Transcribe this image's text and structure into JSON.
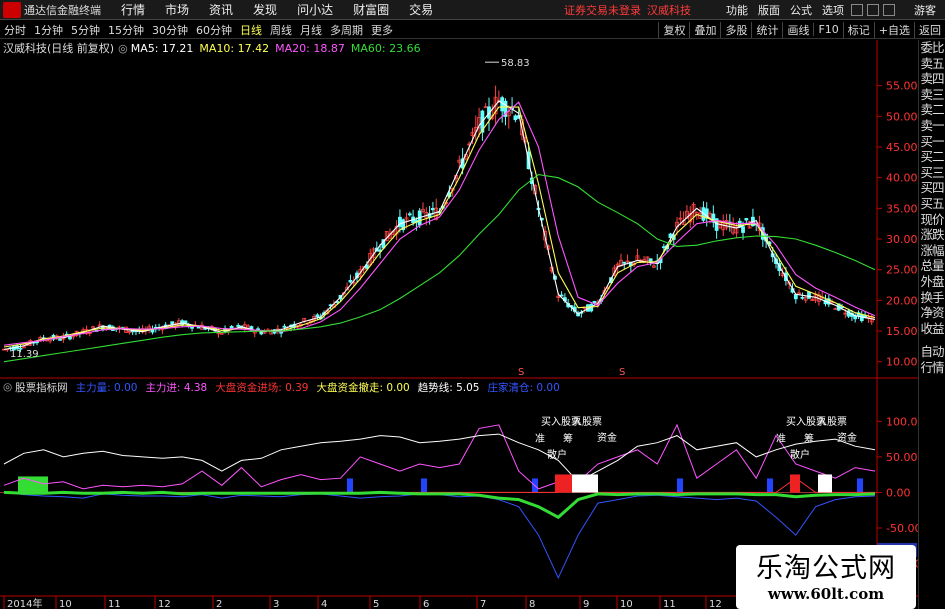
{
  "menubar": {
    "app_title": "通达信金融终端",
    "items": [
      "行情",
      "市场",
      "资讯",
      "发现",
      "问小达",
      "财富圈",
      "交易"
    ],
    "notice": "证券交易未登录",
    "stock": "汉威科技",
    "right_items": [
      "功能",
      "版面",
      "公式",
      "选项"
    ],
    "sidebar_link": "游客"
  },
  "period_bar": {
    "items": [
      "分时",
      "1分钟",
      "5分钟",
      "15分钟",
      "30分钟",
      "60分钟",
      "日线",
      "周线",
      "月线",
      "多周期",
      "更多"
    ],
    "active": "日线",
    "right_buttons": [
      "复权",
      "叠加",
      "多股",
      "统计",
      "画线",
      "F10",
      "标记",
      "+自选",
      "返回"
    ]
  },
  "sidebar": {
    "items": [
      "委比",
      "卖五",
      "卖四",
      "卖三",
      "卖二",
      "卖一",
      "买一",
      "买二",
      "买三",
      "买四",
      "买五",
      "现价",
      "涨跌",
      "涨幅",
      "总量",
      "外盘",
      "换手",
      "净资",
      "收益",
      "自动",
      "行情"
    ]
  },
  "main_header": {
    "title": "汉威科技(日线 前复权)",
    "ma": [
      {
        "label": "MA5: 17.21",
        "color": "#ffffff"
      },
      {
        "label": "MA10: 17.42",
        "color": "#ffff54"
      },
      {
        "label": "MA20: 18.87",
        "color": "#ff55ff"
      },
      {
        "label": "MA60: 23.66",
        "color": "#33dd33"
      }
    ]
  },
  "indicator_header": {
    "title": "股票指标网",
    "items": [
      {
        "label": "主力量: 0.00",
        "color": "#3355ff"
      },
      {
        "label": "主力进: 4.38",
        "color": "#ff55ff"
      },
      {
        "label": "大盘资金进场: 0.39",
        "color": "#ff3333"
      },
      {
        "label": "大盘资金撤走: 0.00",
        "color": "#ffff54"
      },
      {
        "label": "趋势线: 5.05",
        "color": "#ffffff"
      },
      {
        "label": "庄家清仓: 0.00",
        "color": "#3355ff"
      }
    ]
  },
  "chart_data": [
    {
      "type": "candlestick",
      "title": "汉威科技(日线 前复权)",
      "y_ticks": [
        10,
        15,
        20,
        25,
        30,
        35,
        40,
        45,
        50,
        55
      ],
      "ylim": [
        8,
        60
      ],
      "x_ticks": [
        "2014年",
        "10",
        "11",
        "12",
        "2",
        "3",
        "4",
        "5",
        "6",
        "7",
        "8",
        "9",
        "10",
        "11",
        "12"
      ],
      "high_annotation": "58.83",
      "low_annotation": "11.39",
      "markers": [
        "S",
        "S"
      ],
      "series": [
        {
          "name": "MA5",
          "values": [
            12,
            12.6,
            13.8,
            13.9,
            14.8,
            15.8,
            15.3,
            14.9,
            15.7,
            16.3,
            15.7,
            14.8,
            15.7,
            14.9,
            15.2,
            16.4,
            17.3,
            20.5,
            24.5,
            29,
            32.5,
            33.5,
            34.5,
            41.5,
            48.5,
            52.5,
            50.5,
            35,
            21,
            17.8,
            19.5,
            25.5,
            26.5,
            26,
            32,
            35,
            32.5,
            31.8,
            33,
            26.5,
            21,
            20.5,
            19.2,
            17.5,
            16.9
          ]
        },
        {
          "name": "MA10",
          "values": [
            12.4,
            12.9,
            13.7,
            14.2,
            14.9,
            15.5,
            15.4,
            15.1,
            15.5,
            16,
            15.8,
            15.1,
            15.4,
            15,
            15,
            15.9,
            17,
            19.8,
            23.5,
            27.8,
            31.5,
            33,
            34,
            40,
            47,
            51.5,
            51.5,
            39,
            24.5,
            18.8,
            19,
            24.5,
            26.2,
            26.3,
            31,
            34,
            32.9,
            32.2,
            32.5,
            27.6,
            22.3,
            21,
            19.6,
            18,
            17.2
          ]
        },
        {
          "name": "MA20",
          "values": [
            12.7,
            13.1,
            13.5,
            14.1,
            14.6,
            15.2,
            15.4,
            15.3,
            15.4,
            15.7,
            15.8,
            15.4,
            15.3,
            15.1,
            14.9,
            15.4,
            16.5,
            18.5,
            22,
            26,
            30,
            32.2,
            33.6,
            38,
            44.5,
            49.5,
            52.3,
            45,
            30.5,
            20.5,
            19.2,
            22.8,
            25.5,
            26.2,
            29.5,
            32.5,
            33,
            32.5,
            32.6,
            29,
            24.2,
            22,
            20.5,
            18.9,
            17.5
          ]
        },
        {
          "name": "MA60",
          "values": [
            10,
            10.5,
            11,
            11.5,
            12,
            12.5,
            13,
            13.5,
            14,
            14.4,
            14.7,
            14.8,
            14.9,
            15,
            15,
            15.3,
            15.7,
            16.3,
            17.3,
            18.5,
            20.3,
            22.4,
            24.5,
            27.3,
            30.8,
            34,
            38,
            40.5,
            40,
            38.5,
            36,
            34.3,
            32.5,
            30,
            28.8,
            29,
            29.7,
            30.2,
            30.5,
            30.4,
            30,
            29,
            27.8,
            26.5,
            25
          ]
        }
      ]
    },
    {
      "type": "line",
      "title": "股票指标网",
      "y_ticks": [
        100,
        50,
        0,
        -50,
        -100
      ],
      "ylim": [
        -140,
        130
      ],
      "value_label": "-80.89",
      "texts": [
        "买入股票",
        "入股票",
        "准",
        "筹",
        "资金",
        "散户",
        "买入股票",
        "入股票",
        "准",
        "筹",
        "资金",
        "散户"
      ],
      "series": [
        {
          "name": "主力进",
          "color": "#ff55ff",
          "values": [
            10,
            20,
            12,
            15,
            5,
            10,
            8,
            10,
            8,
            12,
            30,
            10,
            35,
            8,
            18,
            25,
            18,
            20,
            50,
            40,
            30,
            40,
            35,
            40,
            90,
            95,
            30,
            5,
            15,
            15,
            40,
            50,
            60,
            40,
            95,
            20,
            40,
            60,
            20,
            80,
            40,
            30,
            20,
            35,
            30
          ]
        },
        {
          "name": "趋势线",
          "color": "#ffffff",
          "values": [
            40,
            55,
            60,
            50,
            55,
            58,
            52,
            50,
            48,
            50,
            45,
            30,
            45,
            48,
            60,
            65,
            70,
            72,
            75,
            80,
            78,
            70,
            72,
            75,
            80,
            82,
            70,
            60,
            45,
            15,
            30,
            45,
            65,
            70,
            80,
            60,
            65,
            70,
            50,
            60,
            68,
            72,
            75,
            65,
            60
          ]
        },
        {
          "name": "主力量",
          "color": "#3355ff",
          "values": [
            0,
            -3,
            -5,
            -6,
            -8,
            -2,
            -4,
            -5,
            -5,
            -6,
            -3,
            -8,
            -4,
            -5,
            -6,
            -3,
            -2,
            -5,
            -8,
            -6,
            -5,
            -2,
            -3,
            -6,
            -5,
            -10,
            -20,
            -60,
            -120,
            -60,
            -15,
            -10,
            -5,
            -4,
            -6,
            -8,
            -10,
            -8,
            -12,
            -35,
            -60,
            -20,
            -10,
            -6,
            -5
          ]
        },
        {
          "name": "大盘资金进场",
          "color": "#ff3333",
          "values": [
            0,
            0,
            0,
            0,
            0,
            0,
            0,
            0,
            0,
            0,
            0,
            0,
            0,
            0,
            0,
            0,
            0,
            0,
            0,
            0,
            0,
            0,
            0,
            0,
            0,
            0,
            0,
            0,
            0,
            20,
            0,
            0,
            0,
            0,
            0,
            0,
            0,
            0,
            0,
            0,
            20,
            0,
            0,
            0,
            0
          ]
        },
        {
          "name": "大盘资金撤走",
          "color": "#ffff54",
          "values": [
            0,
            0,
            0,
            0,
            0,
            0,
            0,
            0,
            0,
            0,
            0,
            0,
            0,
            0,
            0,
            0,
            0,
            0,
            0,
            0,
            0,
            0,
            0,
            0,
            0,
            0,
            0,
            0,
            0,
            0,
            0,
            0,
            0,
            0,
            0,
            0,
            0,
            0,
            0,
            0,
            0,
            0,
            0,
            0,
            0
          ]
        },
        {
          "name": "庄家清仓",
          "color": "#3355ff",
          "values": [
            0,
            0,
            0,
            0,
            0,
            0,
            0,
            0,
            0,
            0,
            0,
            0,
            0,
            0,
            0,
            0,
            0,
            0,
            0,
            0,
            0,
            0,
            0,
            0,
            0,
            0,
            0,
            0,
            0,
            0,
            0,
            0,
            0,
            0,
            0,
            0,
            0,
            0,
            0,
            0,
            0,
            0,
            0,
            0,
            0
          ]
        }
      ]
    }
  ],
  "watermark": {
    "line1": "乐淘公式网",
    "line2": "www.60lt.com"
  },
  "colors": {
    "up": "#ff4444",
    "down": "#66ffff",
    "axis": "#bb0000",
    "price_label": "#ff3333",
    "green": "#33dd33"
  }
}
